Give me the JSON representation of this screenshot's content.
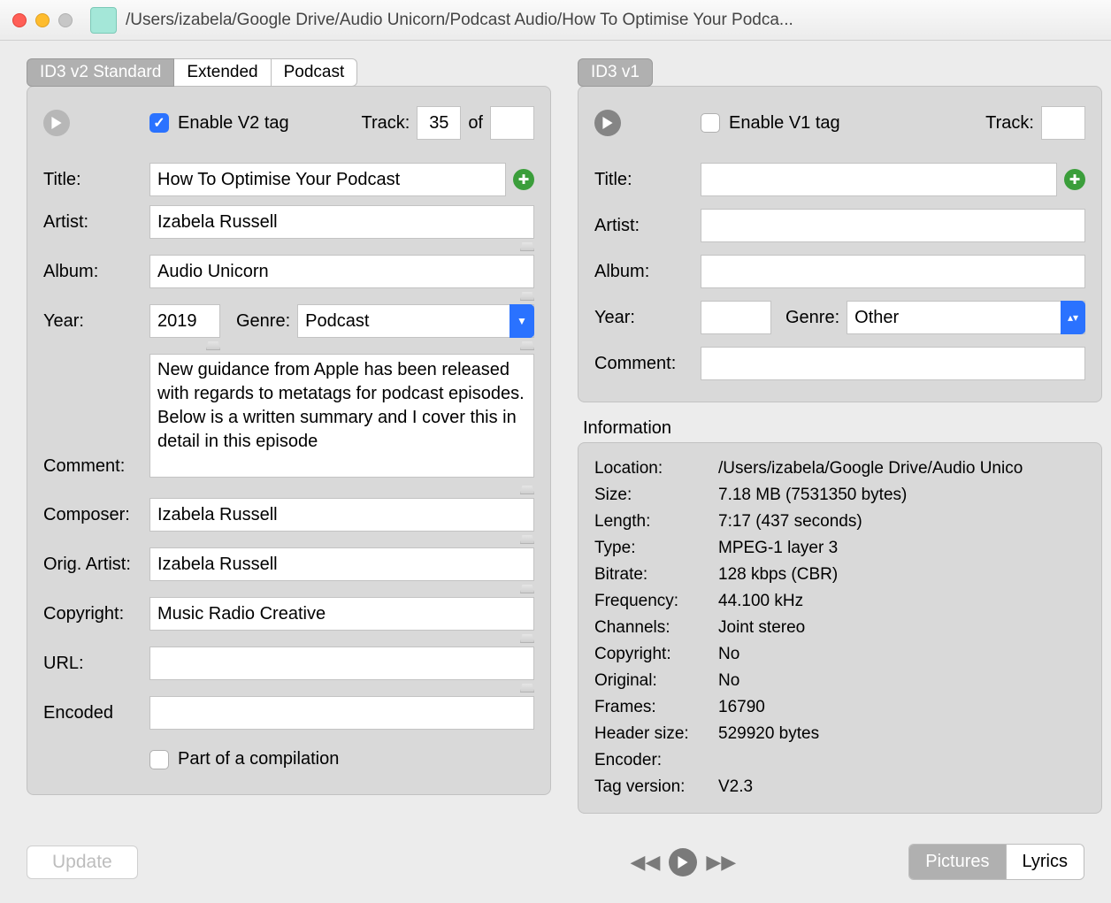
{
  "window_title": "/Users/izabela/Google Drive/Audio Unicorn/Podcast Audio/How To Optimise Your Podca...",
  "v2": {
    "tabs": [
      "ID3 v2 Standard",
      "Extended",
      "Podcast"
    ],
    "enable_label": "Enable V2 tag",
    "track_label": "Track:",
    "track_num": "35",
    "track_of": "of",
    "track_total": "",
    "labels": {
      "title": "Title:",
      "artist": "Artist:",
      "album": "Album:",
      "year": "Year:",
      "genre": "Genre:",
      "comment": "Comment:",
      "composer": "Composer:",
      "orig_artist": "Orig. Artist:",
      "copyright": "Copyright:",
      "url": "URL:",
      "encoded": "Encoded",
      "compilation": "Part of a compilation"
    },
    "values": {
      "title": "How To Optimise Your Podcast",
      "artist": "Izabela Russell",
      "album": "Audio Unicorn",
      "year": "2019",
      "genre": "Podcast",
      "comment": "New guidance from Apple has been released with regards to metatags for podcast episodes. Below is a written summary and I cover this in detail in this episode",
      "composer": "Izabela Russell",
      "orig_artist": "Izabela Russell",
      "copyright": "Music Radio Creative",
      "url": "",
      "encoded": ""
    }
  },
  "v1": {
    "tab": "ID3 v1",
    "enable_label": "Enable V1 tag",
    "track_label": "Track:",
    "track_num": "",
    "labels": {
      "title": "Title:",
      "artist": "Artist:",
      "album": "Album:",
      "year": "Year:",
      "genre": "Genre:",
      "comment": "Comment:"
    },
    "values": {
      "title": "",
      "artist": "",
      "album": "",
      "year": "",
      "genre": "Other",
      "comment": ""
    }
  },
  "info": {
    "header": "Information",
    "rows": {
      "Location:": "/Users/izabela/Google Drive/Audio Unico",
      "Size:": "7.18 MB (7531350 bytes)",
      "Length:": "7:17 (437 seconds)",
      "Type:": "MPEG-1 layer 3",
      "Bitrate:": "128 kbps (CBR)",
      "Frequency:": "44.100 kHz",
      "Channels:": "Joint stereo",
      "Copyright:": "No",
      "Original:": "No",
      "Frames:": "16790",
      "Header size:": "529920 bytes",
      "Encoder:": "",
      "Tag version:": "V2.3"
    }
  },
  "bottom": {
    "update": "Update",
    "pictures": "Pictures",
    "lyrics": "Lyrics"
  }
}
